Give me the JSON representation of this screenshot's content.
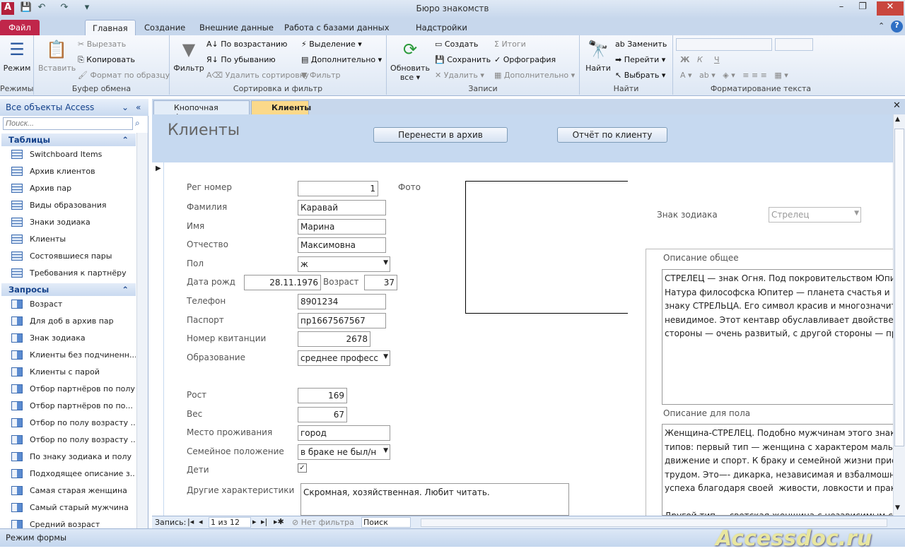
{
  "window": {
    "title": "Бюро знакомств",
    "app_icon": "A"
  },
  "ribbon_tabs": [
    "Файл",
    "Главная",
    "Создание",
    "Внешние данные",
    "Работа с базами данных",
    "Надстройки"
  ],
  "ribbon": {
    "modes": {
      "mode": "Режим",
      "label": "Режимы"
    },
    "clipboard": {
      "paste": "Вставить",
      "cut": "Вырезать",
      "copy": "Копировать",
      "format_painter": "Формат по образцу",
      "label": "Буфер обмена"
    },
    "sort": {
      "filter": "Фильтр",
      "asc": "По возрастанию",
      "desc": "По убыванию",
      "remove_sort": "Удалить сортировку",
      "selection": "Выделение",
      "advanced": "Дополнительно",
      "toggle_filter": "Фильтр",
      "label": "Сортировка и фильтр"
    },
    "records": {
      "refresh": "Обновить все",
      "new": "Создать",
      "save": "Сохранить",
      "delete": "Удалить",
      "totals": "Итоги",
      "spelling": "Орфография",
      "more": "Дополнительно",
      "label": "Записи"
    },
    "find": {
      "find": "Найти",
      "replace": "Заменить",
      "goto": "Перейти",
      "select": "Выбрать",
      "label": "Найти"
    },
    "text": {
      "bold": "Ж",
      "italic": "К",
      "underline": "Ч",
      "label": "Форматирование текста"
    }
  },
  "nav": {
    "title": "Все объекты Access",
    "search_placeholder": "Поиск...",
    "tables_label": "Таблицы",
    "tables": [
      "Switchboard Items",
      "Архив клиентов",
      "Архив пар",
      "Виды образования",
      "Знаки зодиака",
      "Клиенты",
      "Состоявшиеся пары",
      "Требования к партнёру"
    ],
    "queries_label": "Запросы",
    "queries": [
      "Возраст",
      "Для  доб в архив пар",
      "Знак зодиака",
      "Клиенты без подчиненн...",
      "Клиенты с парой",
      "Отбор партнёров по полу",
      "Отбор партнёров по по...",
      "Отбор по полу  возрасту ...",
      "Отбор по полу  возрасту ...",
      "По знаку зодиака и полу",
      "Подходящее описание з...",
      "Самая старая женщина",
      "Самый старый мужчина",
      "Средний возраст"
    ]
  },
  "doc_tabs": [
    "Кнопочная форма",
    "Клиенты"
  ],
  "form": {
    "title": "Клиенты",
    "archive_btn": "Перенести в архив",
    "report_btn": "Отчёт по клиенту",
    "labels": {
      "reg": "Рег номер",
      "last": "Фамилия",
      "first": "Имя",
      "middle": "Отчество",
      "sex": "Пол",
      "dob": "Дата рожд",
      "age": "Возраст",
      "phone": "Телефон",
      "passport": "Паспорт",
      "receipt": "Номер квитанции",
      "edu": "Образование",
      "height": "Рост",
      "weight": "Вес",
      "residence": "Место проживания",
      "marital": "Семейное положение",
      "children": "Дети",
      "other": "Другие характеристики",
      "photo": "Фото",
      "zodiac": "Знак зодиака",
      "desc_general": "Описание общее",
      "desc_sex": "Описание для пола"
    },
    "values": {
      "reg": "1",
      "last": "Каравай",
      "first": "Марина",
      "middle": "Максимовна",
      "sex": "ж",
      "dob": "28.11.1976",
      "age": "37",
      "phone": "8901234",
      "passport": "пр1667567567",
      "receipt": "2678",
      "edu": "среднее професс",
      "height": "169",
      "weight": "67",
      "residence": "город",
      "marital": "в браке не был/н",
      "children": true,
      "other": "Скромная, хозяйственная. Любит читать.",
      "zodiac": "Стрелец",
      "desc_general": "СТРЕЛЕЦ — знак Огня. Под покровительством Юпит\nНатура философска Юпитер — планета счастья и бл\nзнаку СТРЕЛЬЦА. Его символ красив и многозначите\nневидимое. Этот кентавр обуславливает двойствен\nстороны — очень развитый, с другой стороны — пр",
      "desc_sex": "Женщина-СТРЕЛЕЦ. Подобно мужчинам этого знак\nтипов: первый тип — женщина с характером мальч\nдвижение и спорт. К браку и семейной жизни прис\nтрудом. Это—- дикарка, независимая и взбалмошн\nуспеха благодаря своей  живости, ловкости и практ\n\nДругой тип — светская женщина с независимым ск"
    }
  },
  "record_nav": {
    "label": "Запись:",
    "position": "1 из 12",
    "filter": "Нет фильтра",
    "search": "Поиск"
  },
  "status": {
    "text": "Режим формы"
  },
  "watermark": "Accessdoc.ru"
}
